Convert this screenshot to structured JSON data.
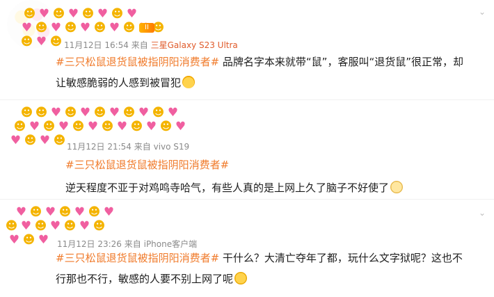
{
  "comments": [
    {
      "date": "11月12日 16:54",
      "source_prefix": "来自",
      "device": "三星Galaxy S23 Ultra",
      "hashtag": "#三只松鼠退货鼠被指阴阳消费者#",
      "line1_rest": " 品牌名字本来就带“鼠”，客服叫“退货鼠”很正常，却",
      "line2": "让敏感脆弱的人感到被冒犯",
      "emoji_end": "laugh-emoji"
    },
    {
      "date": "11月12日 21:54",
      "source_prefix": "来自",
      "device": "vivo S19",
      "hashtag": "#三只松鼠退货鼠被指阴阳消费者#",
      "line2": "逆天程度不亚于对鸡鸣寺哈气，有些人真的是上网上久了脑子不好使了",
      "emoji_end": "cover-mouth-emoji"
    },
    {
      "date": "11月12日 23:26",
      "source_prefix": "来自",
      "device": "iPhone客户端",
      "hashtag": "#三只松鼠退货鼠被指阴阳消费者#",
      "line1_rest": " 干什么？大清亡夺年了都，玩什么文字狱呢？这也不",
      "line2": "行那也不行，敏感的人要不别上网了呢",
      "emoji_end": "grin-emoji"
    }
  ],
  "badge_text": "II",
  "icons": {
    "heart": "heart-emoji",
    "smile": "smile-emoji",
    "chevron": "chevron-down-icon"
  }
}
